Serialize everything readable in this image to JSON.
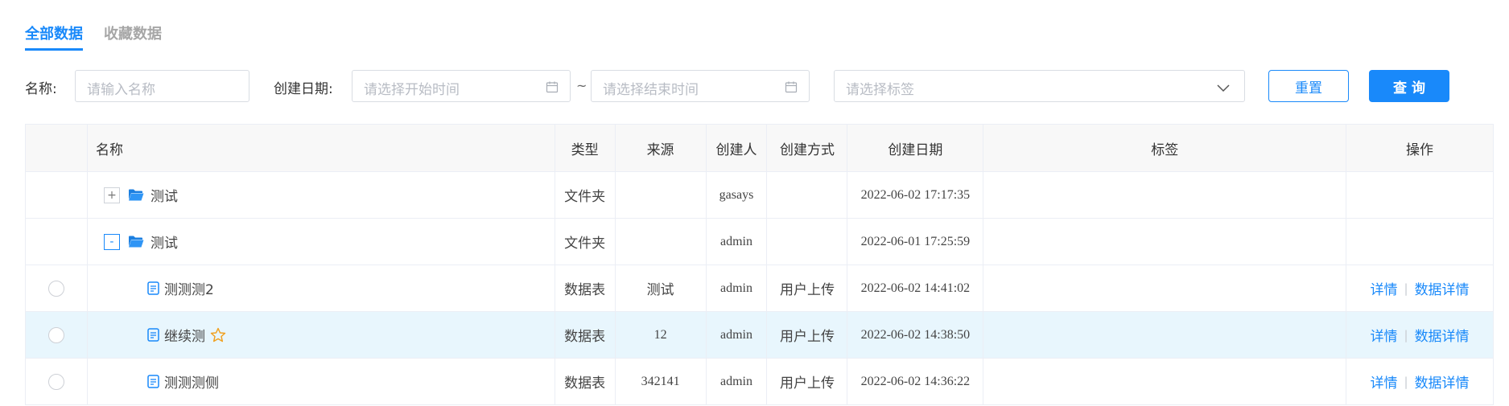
{
  "tabs": {
    "all": "全部数据",
    "favorites": "收藏数据"
  },
  "filters": {
    "name_label": "名称:",
    "name_placeholder": "请输入名称",
    "date_label": "创建日期:",
    "start_placeholder": "请选择开始时间",
    "end_placeholder": "请选择结束时间",
    "range_separator": "~",
    "tag_placeholder": "请选择标签",
    "reset_label": "重置",
    "query_label": "查 询"
  },
  "table": {
    "headers": {
      "name": "名称",
      "type": "类型",
      "source": "来源",
      "creator": "创建人",
      "method": "创建方式",
      "date": "创建日期",
      "tags": "标签",
      "ops": "操作"
    },
    "rows": [
      {
        "kind": "folder",
        "expander": "+",
        "name": "测试",
        "type": "文件夹",
        "source": "",
        "creator": "gasays",
        "method": "",
        "date": "2022-06-02 17:17:35",
        "tags": ""
      },
      {
        "kind": "folder",
        "expander": "-",
        "name": "测试",
        "type": "文件夹",
        "source": "",
        "creator": "admin",
        "method": "",
        "date": "2022-06-01 17:25:59",
        "tags": ""
      },
      {
        "kind": "table",
        "name": "测测测2",
        "type": "数据表",
        "source": "测试",
        "creator": "admin",
        "method": "用户上传",
        "date": "2022-06-02 14:41:02",
        "tags": "",
        "op_detail": "详情",
        "op_data_detail": "数据详情"
      },
      {
        "kind": "table",
        "name": "继续测",
        "starred": true,
        "type": "数据表",
        "source": "12",
        "creator": "admin",
        "method": "用户上传",
        "date": "2022-06-02 14:38:50",
        "tags": "",
        "op_detail": "详情",
        "op_data_detail": "数据详情"
      },
      {
        "kind": "table",
        "name": "测测测侧",
        "type": "数据表",
        "source": "342141",
        "creator": "admin",
        "method": "用户上传",
        "date": "2022-06-02 14:36:22",
        "tags": "",
        "op_detail": "详情",
        "op_data_detail": "数据详情"
      }
    ],
    "op_separator": "|"
  },
  "colors": {
    "accent": "#1989fa",
    "row_highlight": "#e8f6fd",
    "star": "#f0a020"
  },
  "icons": {
    "calendar": "calendar-icon",
    "chevron": "chevron-down-icon",
    "folder": "folder-icon",
    "document": "document-icon",
    "star": "star-outline-icon"
  }
}
